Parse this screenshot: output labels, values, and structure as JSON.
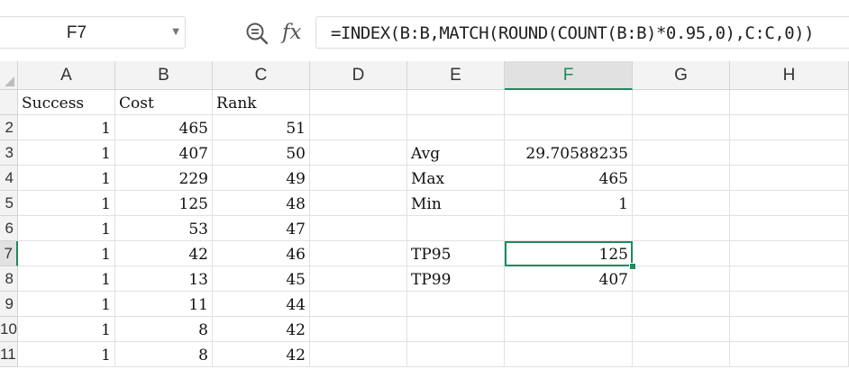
{
  "name_box": {
    "value": "F7"
  },
  "formula_bar": {
    "fx": "fx",
    "formula": "=INDEX(B:B,MATCH(ROUND(COUNT(B:B)*0.95,0),C:C,0))"
  },
  "selected_cell": "F7",
  "accent_color": "#1f8a5b",
  "icons": {
    "zoom": "zoom-in-icon",
    "name_box_dropdown": "chevron-down-icon"
  },
  "columns": [
    "A",
    "B",
    "C",
    "D",
    "E",
    "F",
    "G",
    "H"
  ],
  "rows": [
    {
      "label": "",
      "cells": [
        "Success",
        "Cost",
        "Rank",
        "",
        "",
        "",
        "",
        ""
      ]
    },
    {
      "label": "2",
      "cells": [
        "1",
        "465",
        "51",
        "",
        "",
        "",
        "",
        ""
      ]
    },
    {
      "label": "3",
      "cells": [
        "1",
        "407",
        "50",
        "",
        "Avg",
        "29.70588235",
        "",
        ""
      ]
    },
    {
      "label": "4",
      "cells": [
        "1",
        "229",
        "49",
        "",
        "Max",
        "465",
        "",
        ""
      ]
    },
    {
      "label": "5",
      "cells": [
        "1",
        "125",
        "48",
        "",
        "Min",
        "1",
        "",
        ""
      ]
    },
    {
      "label": "6",
      "cells": [
        "1",
        "53",
        "47",
        "",
        "",
        "",
        "",
        ""
      ]
    },
    {
      "label": "7",
      "cells": [
        "1",
        "42",
        "46",
        "",
        "TP95",
        "125",
        "",
        ""
      ]
    },
    {
      "label": "8",
      "cells": [
        "1",
        "13",
        "45",
        "",
        "TP99",
        "407",
        "",
        ""
      ]
    },
    {
      "label": "9",
      "cells": [
        "1",
        "11",
        "44",
        "",
        "",
        "",
        "",
        ""
      ]
    },
    {
      "label": "10",
      "cells": [
        "1",
        "8",
        "42",
        "",
        "",
        "",
        "",
        ""
      ]
    },
    {
      "label": "11",
      "cells": [
        "1",
        "8",
        "42",
        "",
        "",
        "",
        "",
        ""
      ]
    }
  ]
}
